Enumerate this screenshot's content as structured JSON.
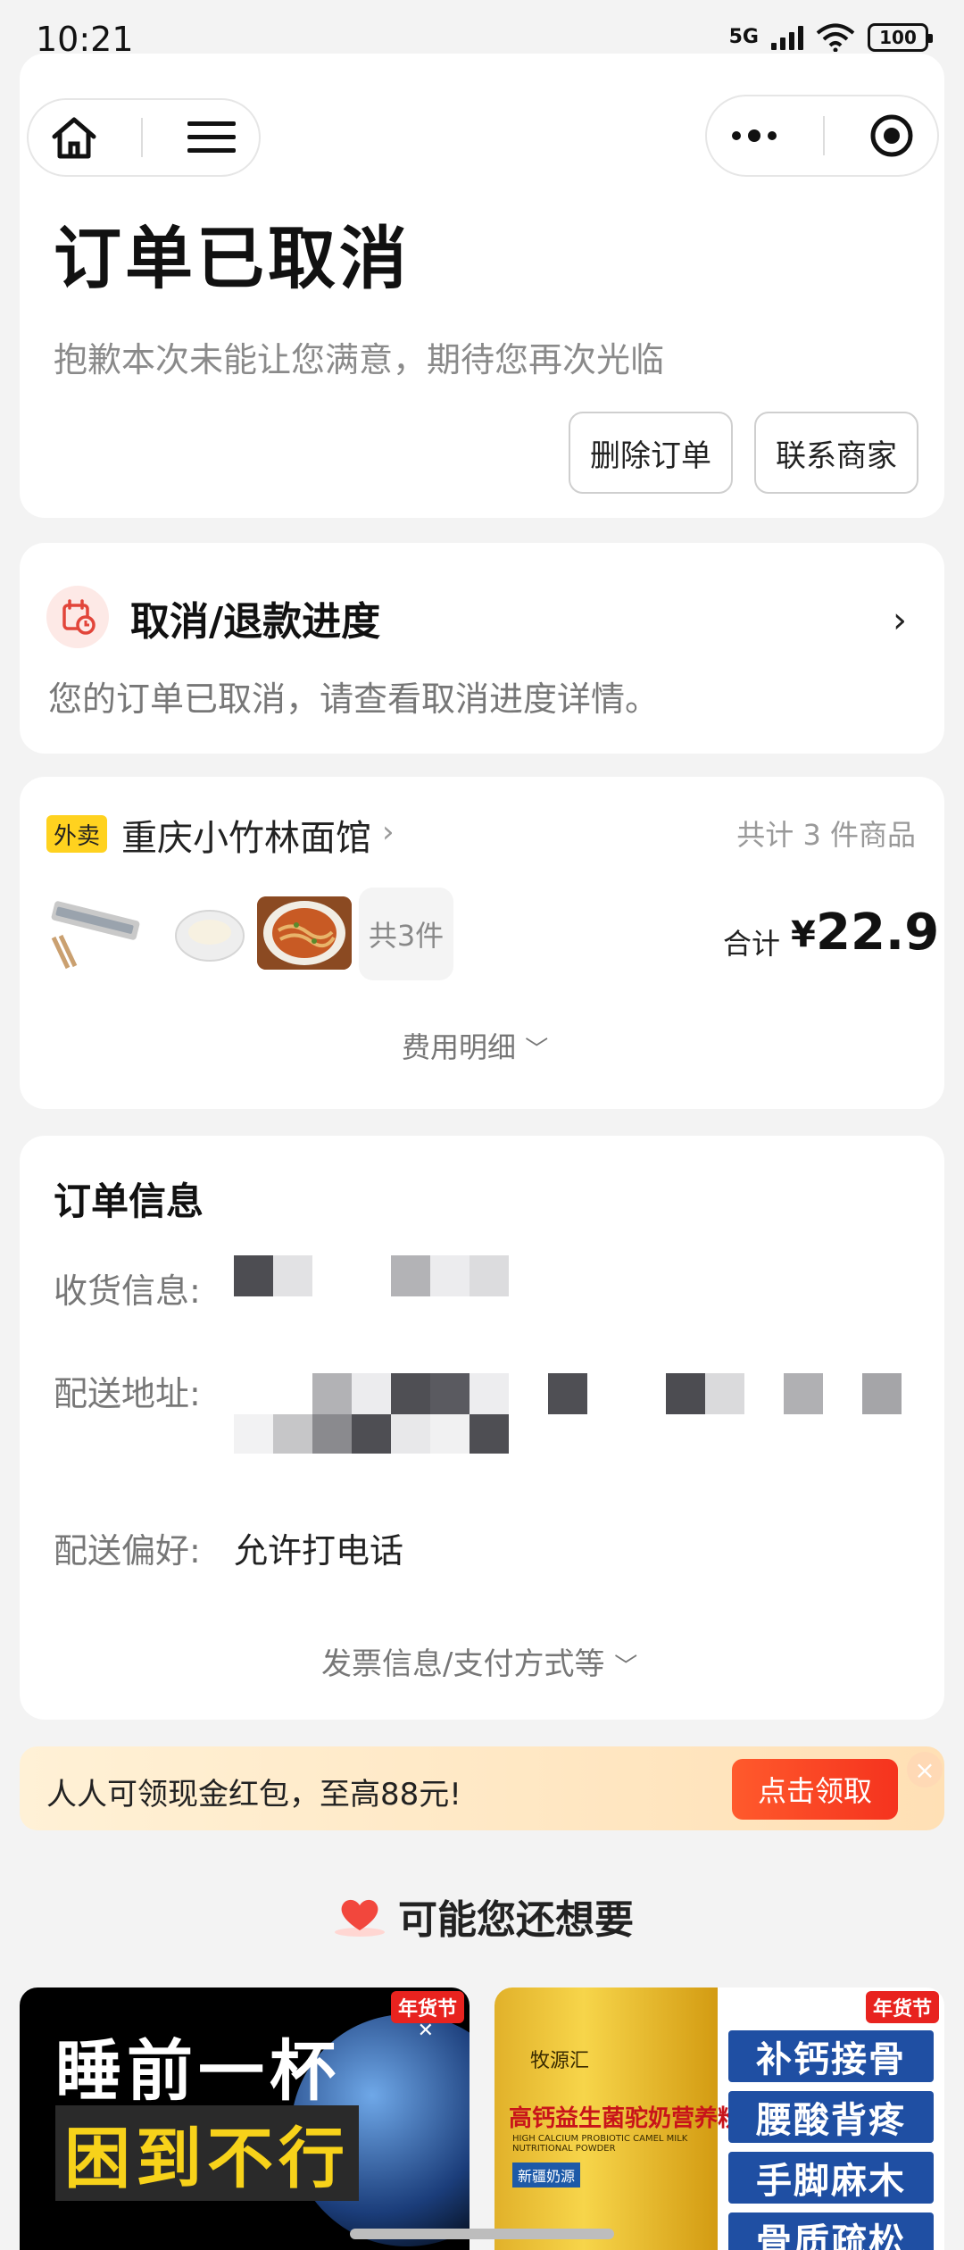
{
  "status_bar": {
    "time": "10:21",
    "network": "5G",
    "battery": "100"
  },
  "order": {
    "status_title": "订单已取消",
    "status_subtitle": "抱歉本次未能让您满意，期待您再次光临",
    "delete_label": "删除订单",
    "contact_label": "联系商家"
  },
  "refund": {
    "title": "取消/退款进度",
    "description": "您的订单已取消，请查看取消进度详情。"
  },
  "shop": {
    "tag": "外卖",
    "name": "重庆小竹林面馆",
    "item_count_text": "共计 3 件商品",
    "more_text": "共3件",
    "total_label": "合计",
    "currency": "¥",
    "total": "22.9",
    "fee_detail": "费用明细"
  },
  "info": {
    "title": "订单信息",
    "receiver_label": "收货信息:",
    "address_label": "配送地址:",
    "preference_label": "配送偏好:",
    "preference_value": "允许打电话",
    "invoice_link": "发票信息/支付方式等"
  },
  "promo": {
    "text": "人人可领现金红包，至高88元!",
    "button": "点击领取"
  },
  "recommend": {
    "title": "可能您还想要",
    "ads": [
      {
        "badge": "年货节",
        "line1": "睡前一杯",
        "line2": "困到不行"
      },
      {
        "badge": "年货节",
        "brand": "牧源汇",
        "product": "高钙益生菌驼奶营养粉",
        "product_en": "HIGH CALCIUM PROBIOTIC CAMEL MILK NUTRITIONAL POWDER",
        "sub": "新疆奶源",
        "tags": [
          "补钙接骨",
          "腰酸背疼",
          "手脚麻木",
          "骨质疏松"
        ]
      }
    ]
  },
  "colors": {
    "accent_red": "#f5331e",
    "tag_yellow": "#ffd21f",
    "banner_bg": "#fff1d6"
  }
}
